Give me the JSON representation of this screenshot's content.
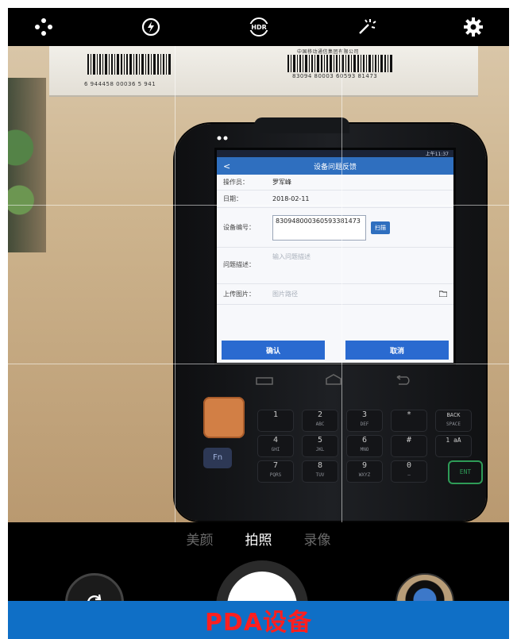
{
  "camera": {
    "top_icons": [
      "more-dots-icon",
      "flash-auto-icon",
      "hdr-icon",
      "magic-wand-icon",
      "settings-gear-icon"
    ],
    "hdr_label": "HDR",
    "modes": [
      "美颜",
      "拍照",
      "录像"
    ],
    "active_mode": "拍照",
    "buttons": {
      "switch_camera": "switch-camera-icon",
      "shutter": "shutter-button",
      "gallery": "gallery-thumbnail"
    }
  },
  "scene": {
    "box_barcode_text_left": "6 944458 00036 5 941",
    "box_barcode_text_right": "83094 80003 60593 81473",
    "box_small_label": "中国移动通信集团有限公司",
    "pda_screen": {
      "status_time": "上午11:37",
      "title": "设备问题反馈",
      "rows": [
        {
          "label": "操作员：",
          "value": "罗军峰"
        },
        {
          "label": "日期：",
          "value": "2018-02-11"
        }
      ],
      "device_code_label": "设备编号：",
      "device_code_value": "830948000360593381473",
      "scan_button": "扫描",
      "problem_label": "问题描述：",
      "problem_placeholder": "输入问题描述",
      "upload_label": "上传图片：",
      "upload_placeholder": "图片路径",
      "confirm_button": "确认",
      "cancel_button": "取消"
    },
    "keypad": {
      "keys": [
        {
          "main": "1",
          "sub": ""
        },
        {
          "main": "2",
          "sub": "ABC"
        },
        {
          "main": "3",
          "sub": "DEF"
        },
        {
          "main": "*",
          "sub": ""
        },
        {
          "main": "BACK",
          "sub": "SPACE"
        },
        {
          "main": "4",
          "sub": "GHI"
        },
        {
          "main": "5",
          "sub": "JKL"
        },
        {
          "main": "6",
          "sub": "MNO"
        },
        {
          "main": "#",
          "sub": ""
        },
        {
          "main": "1 aA",
          "sub": ""
        },
        {
          "main": "7",
          "sub": "PQRS"
        },
        {
          "main": "8",
          "sub": "TUV"
        },
        {
          "main": "9",
          "sub": "WXYZ"
        },
        {
          "main": "0",
          "sub": "—"
        }
      ],
      "fn_label": "Fn",
      "ent_label": "ENT"
    }
  },
  "caption": "PDA设备",
  "colors": {
    "caption_bg": "#0f6fc6",
    "caption_text": "#ff1f1f",
    "pda_blue": "#2f6fbf"
  }
}
